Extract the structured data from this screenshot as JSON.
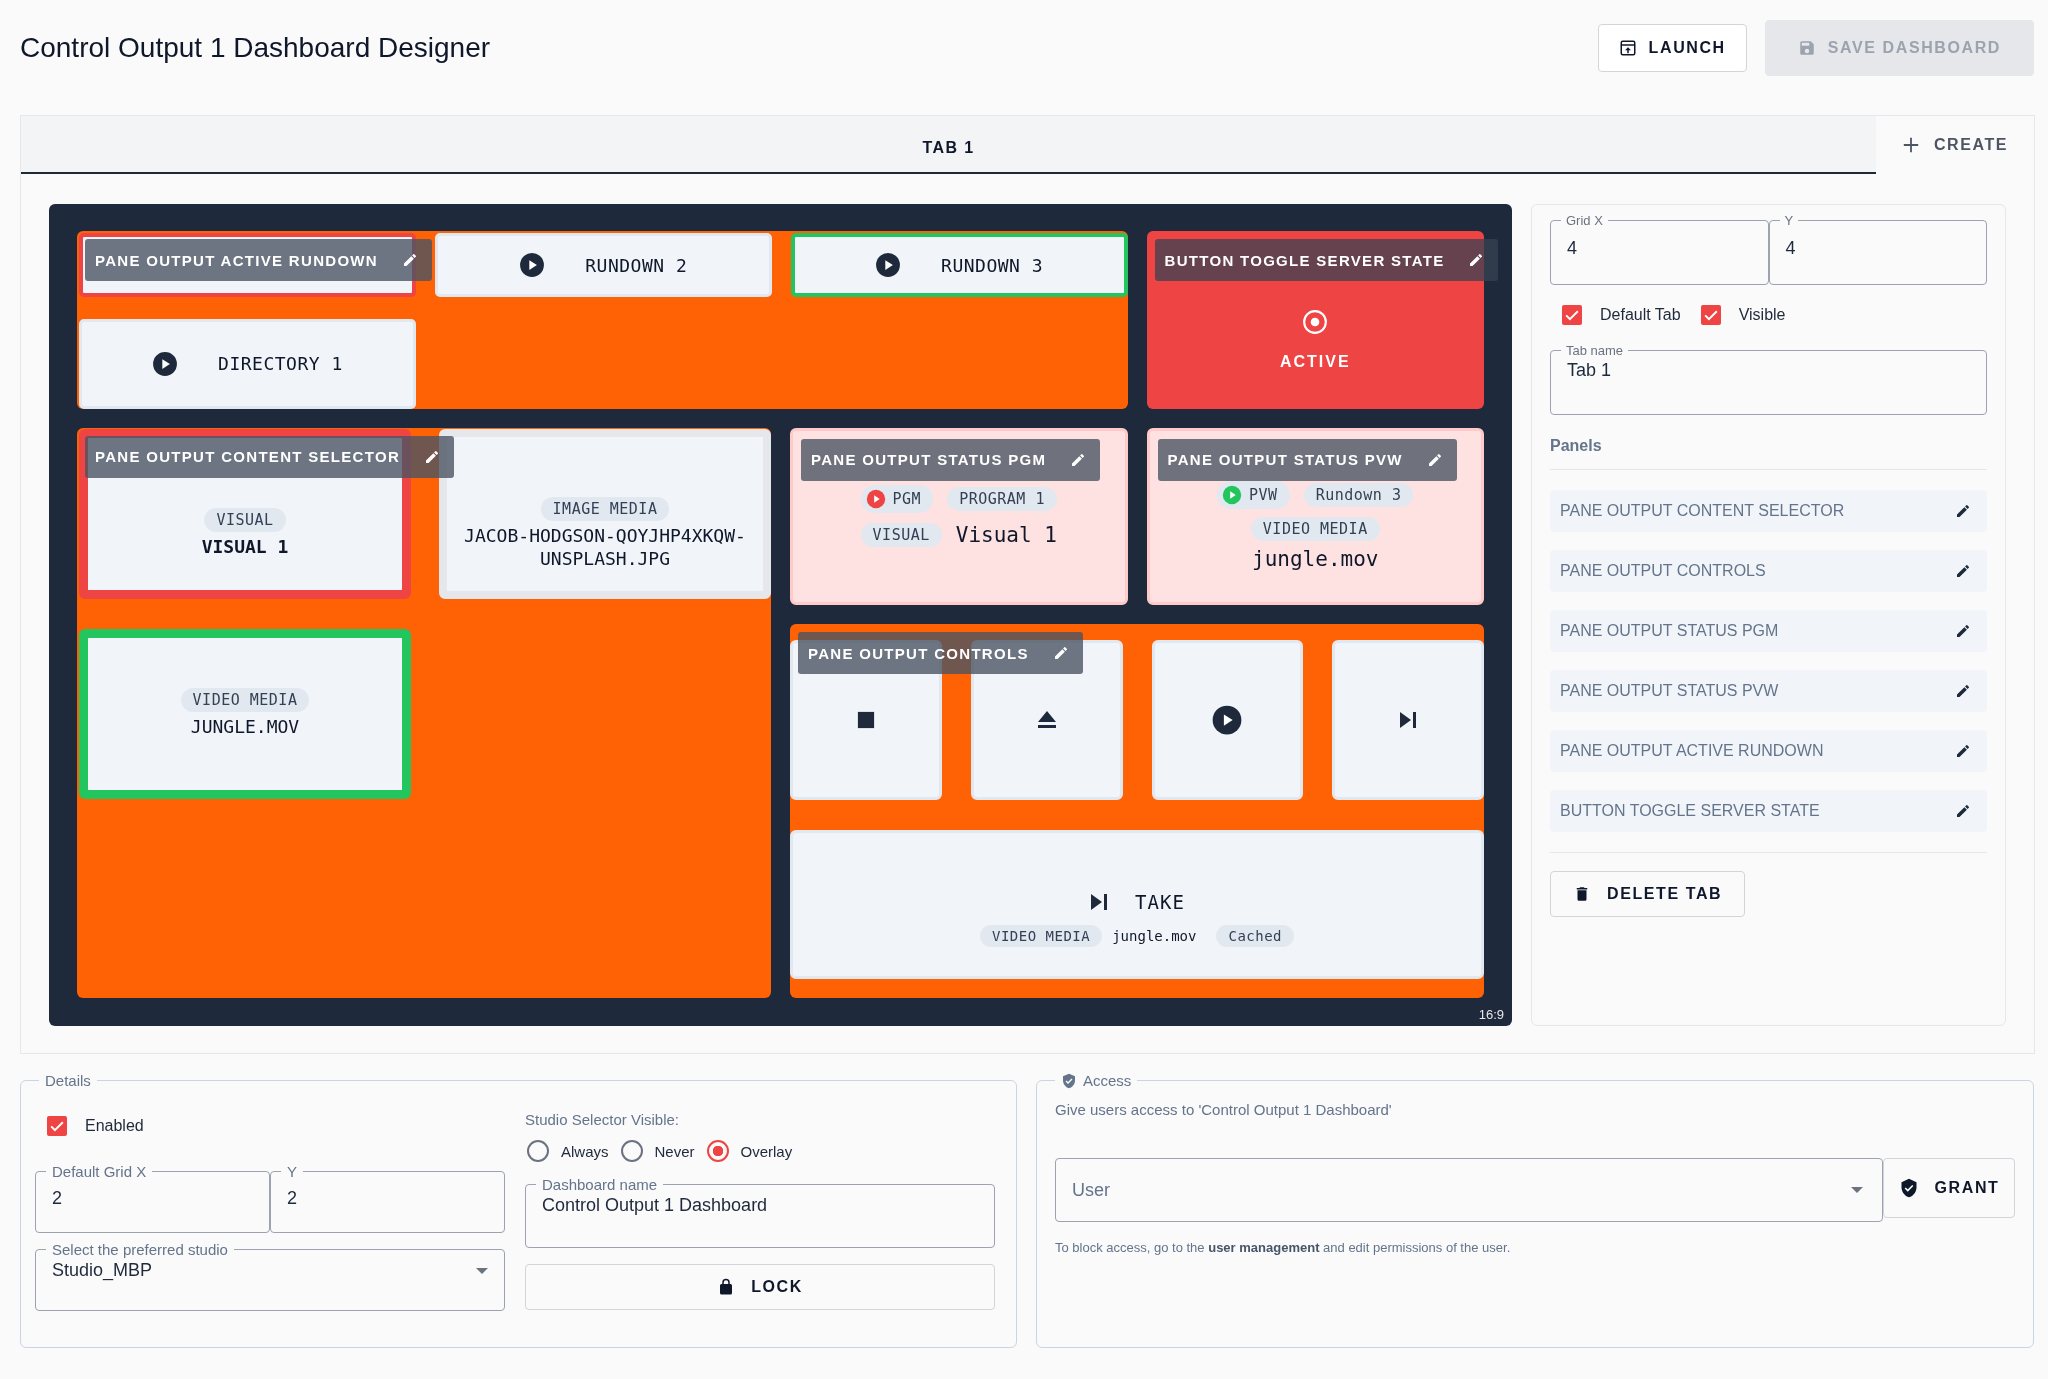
{
  "header": {
    "title": "Control Output 1 Dashboard Designer",
    "buttons": [
      {
        "kind": "launch",
        "label": "LAUNCH",
        "disabled": false
      },
      {
        "kind": "save",
        "label": "SAVE DASHBOARD",
        "disabled": true
      }
    ]
  },
  "tabs": [
    {
      "label": "TAB 1",
      "selected": true
    }
  ],
  "create_button": "CREATE",
  "canvas": {
    "aspect": "16:9",
    "panes": [
      {
        "kind": "rundowns",
        "label": "PANE OUTPUT ACTIVE RUNDOWN",
        "items": [
          {
            "on_program": true,
            "on_preview": false
          },
          {
            "label": "RUNDOWN 2",
            "on_program": false,
            "on_preview": false
          },
          {
            "label": "RUNDOWN 3",
            "on_program": false,
            "on_preview": true
          },
          {
            "label": "DIRECTORY 1",
            "on_program": false,
            "on_preview": false
          }
        ]
      },
      {
        "kind": "toggle",
        "label": "BUTTON TOGGLE SERVER STATE",
        "text": "ACTIVE",
        "active": true
      },
      {
        "kind": "content_selector",
        "label": "PANE OUTPUT CONTENT SELECTOR",
        "items": [
          {
            "tag": "VISUAL",
            "name": "VISUAL 1",
            "on_program": true,
            "on_preview": false
          },
          {
            "tag": "IMAGE MEDIA",
            "name": "JACOB-HODGSON-QOYJHP4XKQW-UNSPLASH.JPG",
            "on_program": false,
            "on_preview": false
          },
          {
            "tag": "VIDEO MEDIA",
            "name": "JUNGLE.MOV",
            "on_program": false,
            "on_preview": true
          }
        ]
      },
      {
        "kind": "status",
        "label": "PANE OUTPUT STATUS PGM",
        "indicator": {
          "label": "PGM",
          "color": "#ef4444"
        },
        "rundown": "PROGRAM 1",
        "tag": "VISUAL",
        "name": "Visual 1",
        "tag_above": false
      },
      {
        "kind": "status",
        "label": "PANE OUTPUT STATUS PVW",
        "indicator": {
          "label": "PVW",
          "color": "#22c55e"
        },
        "rundown": "Rundown 3",
        "tag": "VIDEO MEDIA",
        "name": "jungle.mov",
        "tag_above": true
      },
      {
        "kind": "controls",
        "label": "PANE OUTPUT CONTROLS",
        "buttons": [
          {
            "kind": "stop"
          },
          {
            "kind": "eject"
          },
          {
            "kind": "play"
          },
          {
            "kind": "next"
          }
        ],
        "take": {
          "label": "TAKE",
          "tag": "VIDEO MEDIA",
          "name": "jungle.mov",
          "status": "Cached"
        }
      }
    ]
  },
  "tab_settings": {
    "grid_x": {
      "label": "Grid X",
      "value": "4"
    },
    "grid_y": {
      "label": "Y",
      "value": "4"
    },
    "checkboxes": [
      {
        "label": "Default Tab",
        "checked": true
      },
      {
        "label": "Visible",
        "checked": true
      }
    ],
    "tab_name": {
      "label": "Tab name",
      "value": "Tab 1"
    },
    "panels_heading": "Panels",
    "panels": [
      "PANE OUTPUT CONTENT SELECTOR",
      "PANE OUTPUT CONTROLS",
      "PANE OUTPUT STATUS PGM",
      "PANE OUTPUT STATUS PVW",
      "PANE OUTPUT ACTIVE RUNDOWN",
      "BUTTON TOGGLE SERVER STATE"
    ],
    "delete_button": "DELETE TAB"
  },
  "details": {
    "title": "Details",
    "enabled": {
      "label": "Enabled",
      "checked": true
    },
    "studio_selector": {
      "label": "Studio Selector Visible:",
      "options": [
        {
          "label": "Always",
          "selected": false
        },
        {
          "label": "Never",
          "selected": false
        },
        {
          "label": "Overlay",
          "selected": true
        }
      ]
    },
    "grid_x": {
      "label": "Default Grid X",
      "value": "2"
    },
    "grid_y": {
      "label": "Y",
      "value": "2"
    },
    "dashboard_name": {
      "label": "Dashboard name",
      "value": "Control Output 1 Dashboard"
    },
    "studio": {
      "label": "Select the preferred studio",
      "value": "Studio_MBP"
    },
    "lock_button": "LOCK"
  },
  "access": {
    "title": "Access",
    "description": "Give users access to 'Control Output 1 Dashboard'",
    "user_select": {
      "placeholder": "User"
    },
    "grant_button": "GRANT",
    "note": "To block access, go to the **user management** and edit permissions of the user."
  }
}
